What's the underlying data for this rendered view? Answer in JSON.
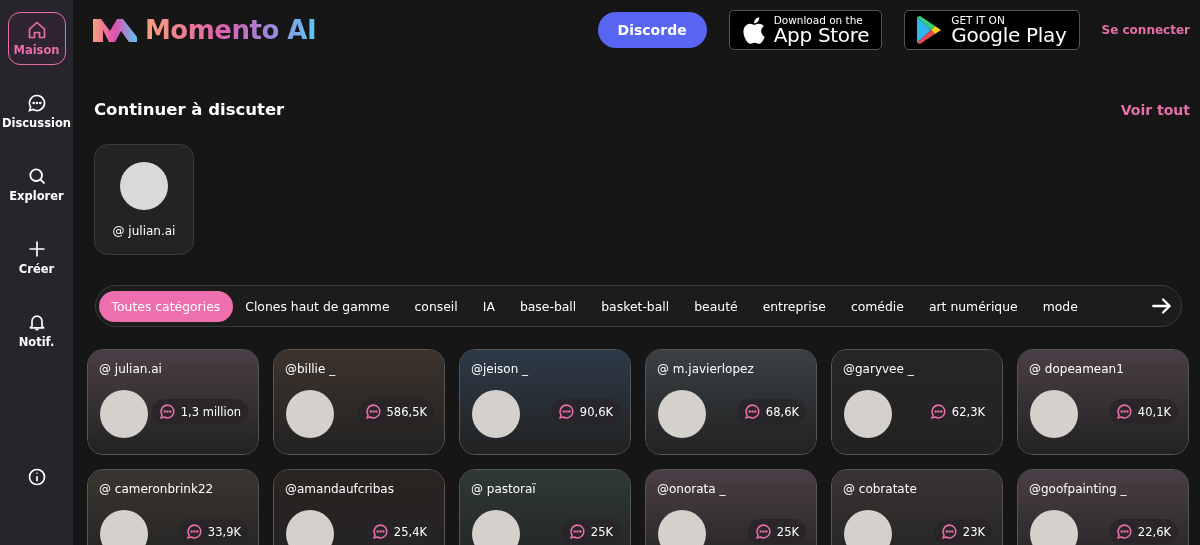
{
  "sidebar": {
    "items": [
      {
        "label": "Maison",
        "selected": true
      },
      {
        "label": "Discussion",
        "selected": false
      },
      {
        "label": "Explorer",
        "selected": false
      },
      {
        "label": "Créer",
        "selected": false
      },
      {
        "label": "Notif.",
        "selected": false
      }
    ]
  },
  "header": {
    "logo": "Momento AI",
    "discord_button": "Discorde",
    "app_store": {
      "small": "Download on the",
      "large": "App Store"
    },
    "google_play": {
      "small": "GET IT ON",
      "large": "Google Play"
    },
    "login": "Se connecter"
  },
  "continue_section": {
    "title": "Continuer à discuter",
    "see_all": "Voir tout",
    "chats": [
      {
        "handle": "@ julian.ai"
      }
    ]
  },
  "categories": [
    {
      "label": "Toutes catégories",
      "selected": true
    },
    {
      "label": "Clones haut de gamme",
      "selected": false
    },
    {
      "label": "conseil",
      "selected": false
    },
    {
      "label": "IA",
      "selected": false
    },
    {
      "label": "base-ball",
      "selected": false
    },
    {
      "label": "basket-ball",
      "selected": false
    },
    {
      "label": "beauté",
      "selected": false
    },
    {
      "label": "entreprise",
      "selected": false
    },
    {
      "label": "comédie",
      "selected": false
    },
    {
      "label": "art numérique",
      "selected": false
    },
    {
      "label": "mode",
      "selected": false
    }
  ],
  "characters": [
    {
      "handle": "@ julian.ai",
      "count": "1,3 million"
    },
    {
      "handle": "@billie _",
      "count": "586,5K"
    },
    {
      "handle": "@jeison _",
      "count": "90,6K"
    },
    {
      "handle": "@ m.javierlopez",
      "count": "68,6K"
    },
    {
      "handle": "@garyvee _",
      "count": "62,3K"
    },
    {
      "handle": "@ dopeamean1",
      "count": "40,1K"
    },
    {
      "handle": "@ cameronbrink22",
      "count": "33,9K"
    },
    {
      "handle": "@amandaufcribas",
      "count": "25,4K"
    },
    {
      "handle": "@ pastoraï",
      "count": "25K"
    },
    {
      "handle": "@onorata _",
      "count": "25K"
    },
    {
      "handle": "@ cobratate",
      "count": "23K"
    },
    {
      "handle": "@goofpainting _",
      "count": "22,6K"
    }
  ]
}
